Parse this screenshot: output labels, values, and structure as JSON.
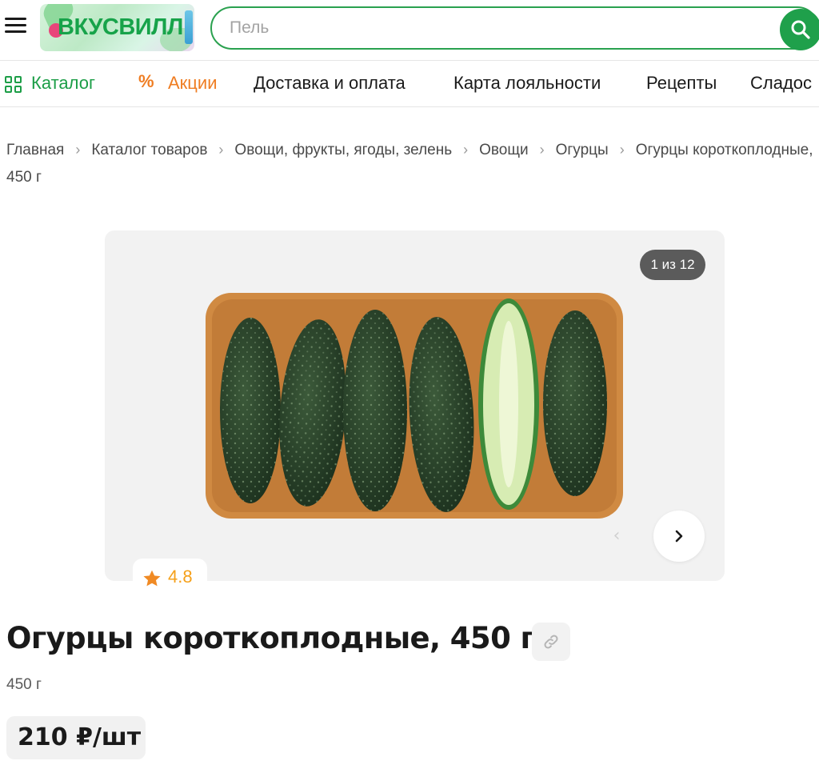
{
  "header": {
    "logo_text": "ВКУСВИЛЛ",
    "search_placeholder": "Пель",
    "accent_color": "#1fa04b"
  },
  "nav": {
    "items": [
      {
        "label": "Каталог",
        "icon": "grid-icon",
        "color": "#1c9e47"
      },
      {
        "label": "Акции",
        "icon": "percent-icon",
        "color": "#ef7d22"
      },
      {
        "label": "Доставка и оплата"
      },
      {
        "label": "Карта лояльности"
      },
      {
        "label": "Рецепты"
      },
      {
        "label": "Сладос"
      }
    ]
  },
  "breadcrumb": {
    "items": [
      "Главная",
      "Каталог товаров",
      "Овощи, фрукты, ягоды, зелень",
      "Овощи",
      "Огурцы",
      "Огурцы короткоплодные, 450 г"
    ]
  },
  "gallery": {
    "counter": "1 из 12",
    "image_icon": "cucumbers-tray-image"
  },
  "product": {
    "rating": "4.8",
    "title": "Огурцы короткоплодные, 450 г",
    "weight": "450 г",
    "price": "210 ₽/шт"
  }
}
